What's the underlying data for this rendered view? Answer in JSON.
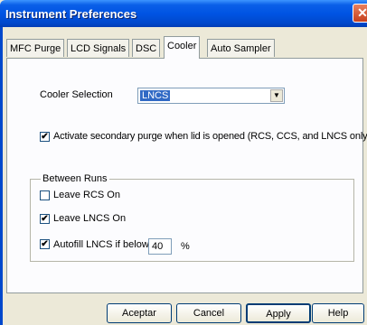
{
  "window": {
    "title": "Instrument Preferences",
    "close_glyph": "✕"
  },
  "tabs": [
    {
      "label": "MFC Purge"
    },
    {
      "label": "LCD Signals"
    },
    {
      "label": "DSC"
    },
    {
      "label": "Cooler",
      "active": true
    },
    {
      "label": "Auto Sampler"
    }
  ],
  "cooler": {
    "selection_label": "Cooler Selection",
    "selection_value": "LNCS",
    "secondary_purge_label": "Activate secondary purge when lid is opened (RCS, CCS, and LNCS only)",
    "secondary_purge_checked": true
  },
  "between_runs": {
    "legend": "Between Runs",
    "leave_rcs_on_label": "Leave RCS On",
    "leave_rcs_on_checked": false,
    "leave_lncs_on_label": "Leave LNCS On",
    "leave_lncs_on_checked": true,
    "autofill_label": "Autofill LNCS if below",
    "autofill_checked": true,
    "autofill_value": "40",
    "autofill_unit": "%"
  },
  "buttons": {
    "ok": "Aceptar",
    "cancel": "Cancel",
    "apply": "Apply",
    "help": "Help"
  },
  "colors": {
    "titlebar": "#0054e3",
    "selection_highlight": "#316ac5"
  },
  "icons": {
    "dropdown": "chevron-down-icon",
    "check": "checkmark-icon"
  },
  "glyphs": {
    "check": "✔",
    "dropdown": "▼"
  }
}
